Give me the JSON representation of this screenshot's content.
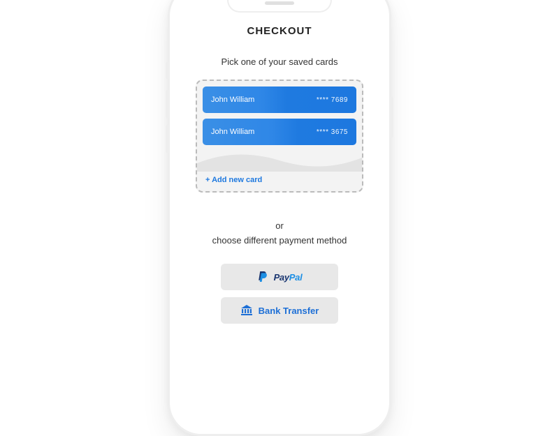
{
  "title": "CHECKOUT",
  "subtitle": "Pick one of your saved cards",
  "cards": [
    {
      "name": "John William",
      "digits": "**** 7689"
    },
    {
      "name": "John William",
      "digits": "**** 3675"
    }
  ],
  "add_card_label": "+ Add new card",
  "or_label": "or",
  "choose_label": "choose different payment method",
  "paypal": {
    "prefix": "Pay",
    "suffix": "Pal"
  },
  "bank_transfer_label": "Bank Transfer",
  "colors": {
    "accent": "#1d78df"
  }
}
